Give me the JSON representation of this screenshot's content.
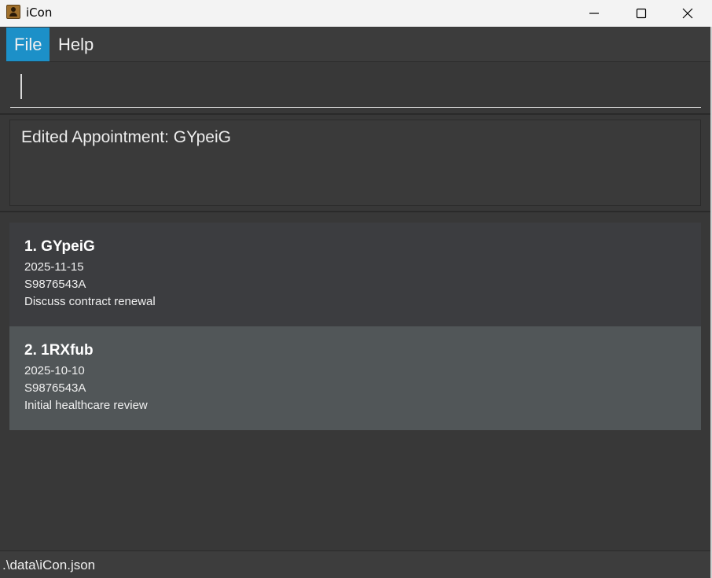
{
  "window": {
    "title": "iCon",
    "app_icon": "contacts-book-icon",
    "controls": {
      "minimize_icon": "minimize-icon",
      "maximize_icon": "maximize-icon",
      "close_icon": "close-icon"
    }
  },
  "menu": {
    "items": [
      {
        "label": "File",
        "active": true
      },
      {
        "label": "Help",
        "active": false
      }
    ]
  },
  "command": {
    "value": "",
    "placeholder": ""
  },
  "result": {
    "message": "Edited Appointment: GYpeiG"
  },
  "appointments": [
    {
      "title": "1. GYpeiG",
      "date": "2025-11-15",
      "nric": "S9876543A",
      "description": "Discuss contract renewal"
    },
    {
      "title": "2. 1RXfub",
      "date": "2025-10-10",
      "nric": "S9876543A",
      "description": "Initial healthcare review"
    }
  ],
  "status": {
    "file_path": ".\\data\\iCon.json"
  },
  "colors": {
    "accent": "#1c90c8",
    "background": "#383838",
    "card_default": "#3c3d40",
    "card_selected": "#515658"
  }
}
